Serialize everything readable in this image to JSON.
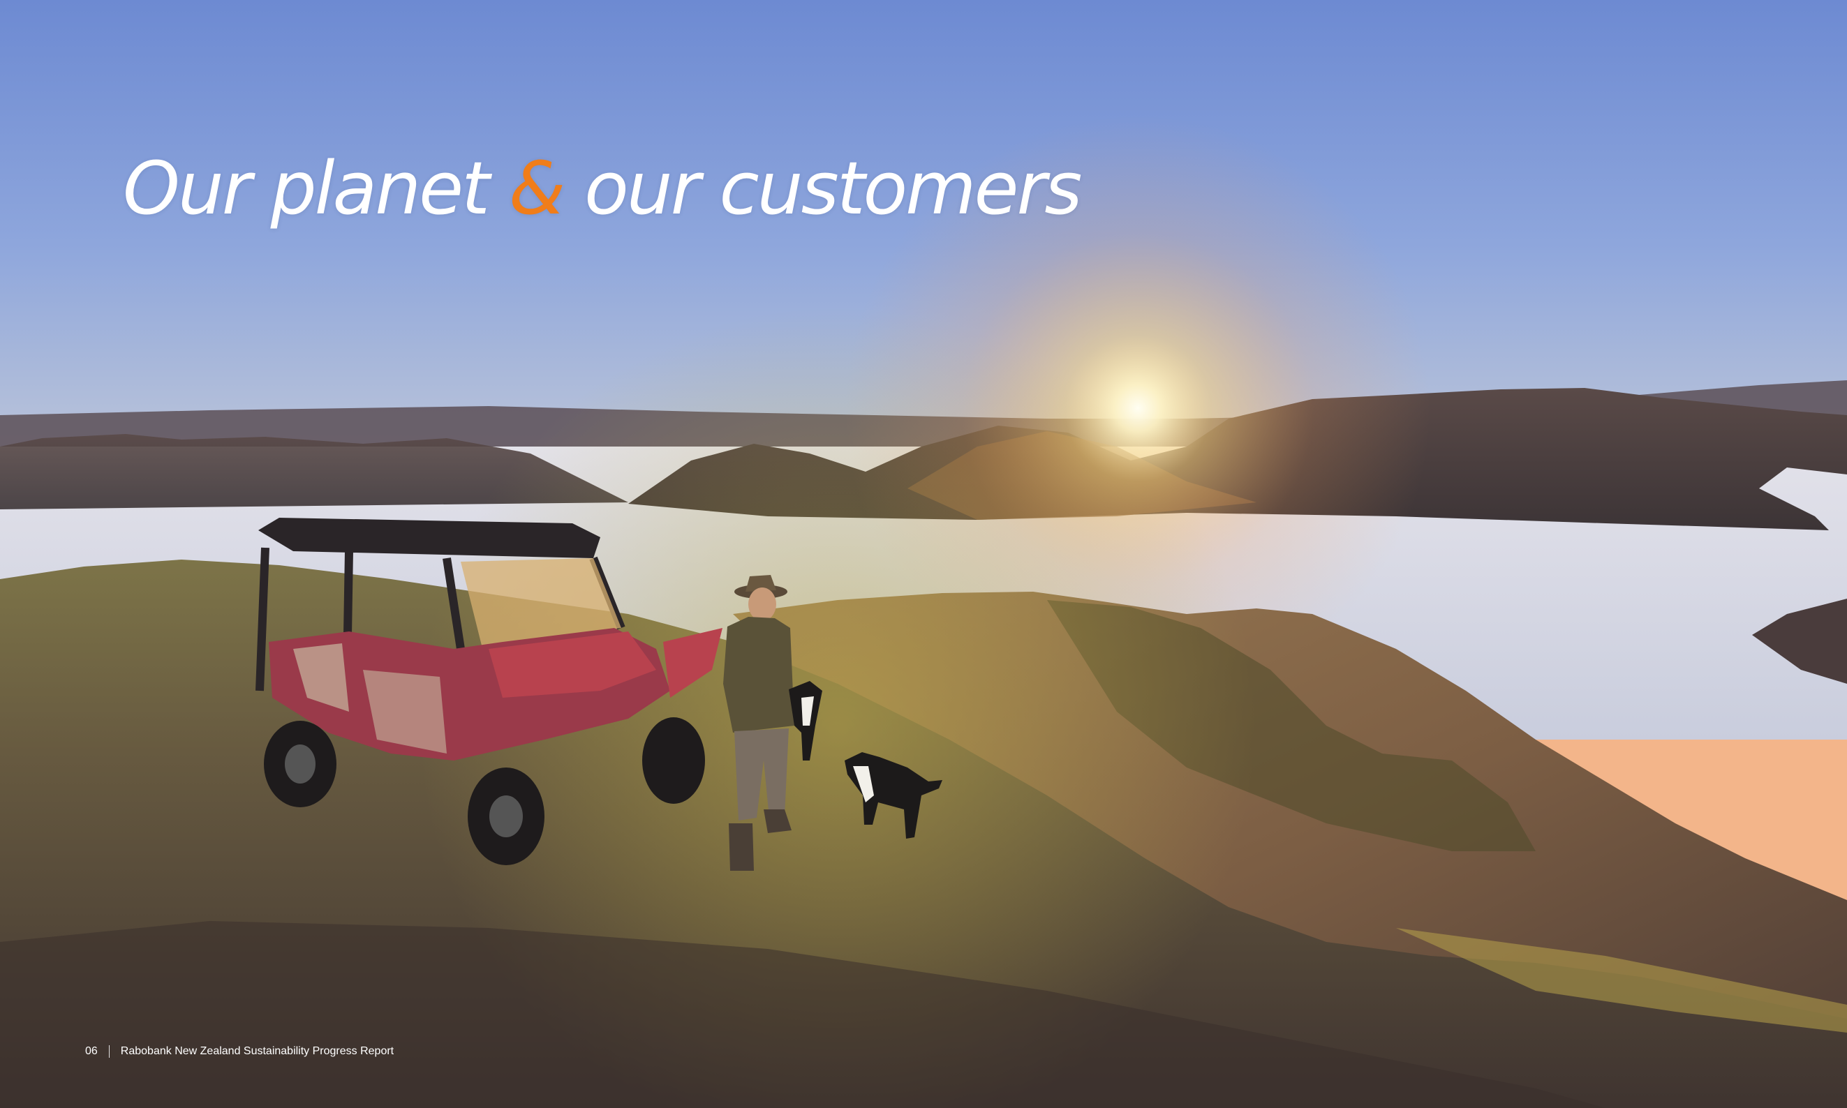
{
  "title": {
    "part1": "Our planet ",
    "ampersand": "&",
    "part2": " our customers"
  },
  "footer": {
    "page_number": "06",
    "report_name": "Rabobank New Zealand Sustainability Progress Report"
  },
  "colors": {
    "accent": "#f07d1a",
    "text": "#ffffff"
  }
}
